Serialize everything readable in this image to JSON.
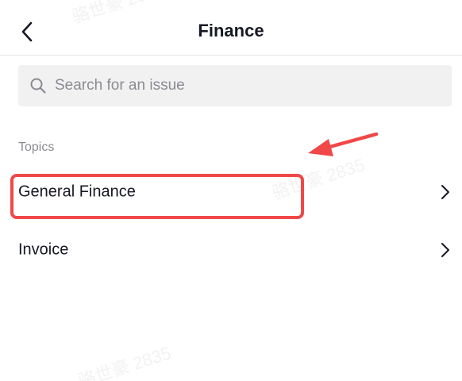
{
  "header": {
    "title": "Finance",
    "back_icon": "chevron-left-icon"
  },
  "search": {
    "placeholder": "Search for an issue",
    "icon": "search-icon"
  },
  "topics": {
    "section_label": "Topics",
    "items": [
      {
        "label": "General Finance",
        "icon": "chevron-right-icon",
        "highlighted": true
      },
      {
        "label": "Invoice",
        "icon": "chevron-right-icon",
        "highlighted": false
      }
    ]
  },
  "annotation": {
    "color": "#f04848"
  },
  "watermark": {
    "text": "骆世豪 2835"
  }
}
